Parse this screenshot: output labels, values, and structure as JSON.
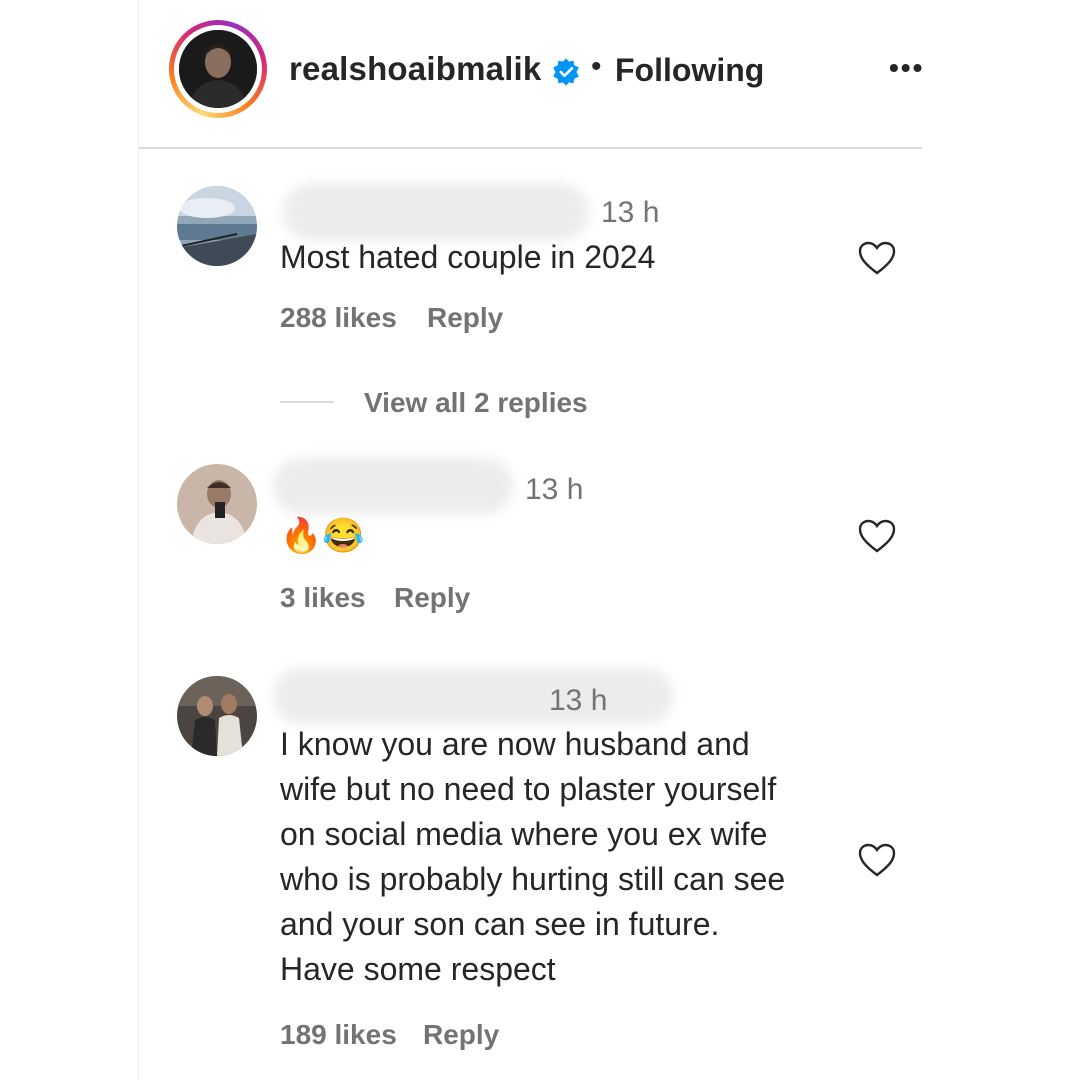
{
  "post_header": {
    "username": "realshoaibmalik",
    "verified_icon": "verified-badge-icon",
    "separator": "•",
    "following_label": "Following",
    "more_label": "•••"
  },
  "comments": [
    {
      "time": "13 h",
      "text": "Most hated couple in 2024",
      "likes": "288 likes",
      "reply_label": "Reply",
      "view_replies": "View all 2 replies"
    },
    {
      "time": "13 h",
      "text": "🔥😂",
      "likes": "3 likes",
      "reply_label": "Reply"
    },
    {
      "time": "13 h",
      "text_lines": [
        "I know you are now husband and",
        "wife but no need to plaster yourself",
        "on social media where you ex wife",
        "who is probably hurting still can see",
        "and your son can see in future.",
        "Have some respect"
      ],
      "likes": "189 likes",
      "reply_label": "Reply"
    }
  ],
  "colors": {
    "accent": "#0095f6",
    "secondary_text": "#737373",
    "primary_text": "#262626",
    "divider": "#dbdbdb"
  }
}
